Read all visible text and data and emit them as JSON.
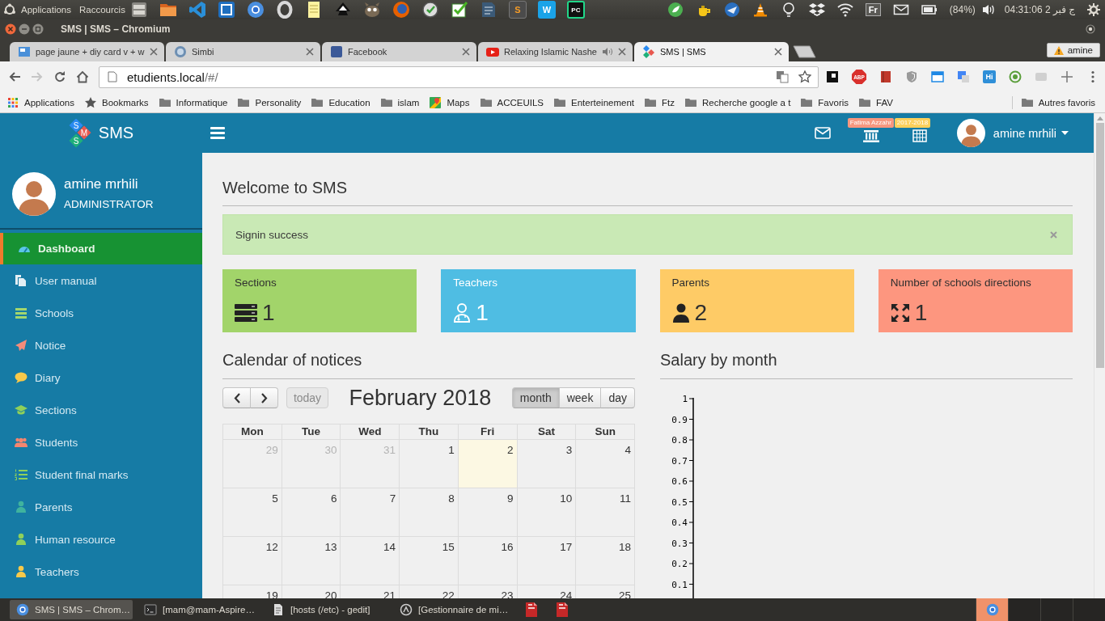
{
  "top_panel": {
    "menus": [
      "Applications",
      "Raccourcis"
    ],
    "launcher_labels": [
      "S",
      "W",
      "PC"
    ],
    "keyboard_layout": "Fr",
    "battery": "(84%)",
    "clock": "ج فبر 2 04:31:06"
  },
  "window": {
    "title": "SMS | SMS – Chromium"
  },
  "browser": {
    "tabs": [
      {
        "label": "page jaune + diy card v + w",
        "selected": false,
        "audio": false
      },
      {
        "label": "Simbi",
        "selected": false,
        "audio": false
      },
      {
        "label": "Facebook",
        "selected": false,
        "audio": false
      },
      {
        "label": "Relaxing Islamic Nashe",
        "selected": false,
        "audio": true
      },
      {
        "label": "SMS | SMS",
        "selected": true,
        "audio": false
      }
    ],
    "profile": "amine",
    "forward_disabled": true,
    "address": {
      "host": "etudients.local",
      "path": "/#/"
    },
    "extension_labels": [
      "ABP",
      "Hi"
    ],
    "bookmarks": [
      {
        "kind": "apps",
        "label": "Applications"
      },
      {
        "kind": "star",
        "label": "Bookmarks"
      },
      {
        "kind": "folder",
        "label": "Informatique"
      },
      {
        "kind": "folder",
        "label": "Personality"
      },
      {
        "kind": "folder",
        "label": "Education"
      },
      {
        "kind": "folder",
        "label": "islam"
      },
      {
        "kind": "site",
        "label": "Maps"
      },
      {
        "kind": "folder",
        "label": "ACCEUILS"
      },
      {
        "kind": "folder",
        "label": "Enterteinement"
      },
      {
        "kind": "folder",
        "label": "Ftz"
      },
      {
        "kind": "folder",
        "label": "Recherche google a t"
      },
      {
        "kind": "folder",
        "label": "Favoris"
      },
      {
        "kind": "folder",
        "label": "FAV"
      }
    ],
    "other_bookmarks": "Autres favoris"
  },
  "app": {
    "logo_letters": [
      "S",
      "M",
      "S"
    ],
    "brand": "SMS",
    "badges": [
      {
        "text": "Fatima Azzahr",
        "color": "#f7977f"
      },
      {
        "text": "2017-2018",
        "color": "#fcd05c"
      }
    ],
    "user": "amine mrhili",
    "sidebar": {
      "name": "amine mrhili",
      "role": "ADMINISTRATOR",
      "items": [
        {
          "label": "Dashboard",
          "selected": true
        },
        {
          "label": "User manual",
          "selected": false
        },
        {
          "label": "Schools",
          "selected": false
        },
        {
          "label": "Notice",
          "selected": false
        },
        {
          "label": "Diary",
          "selected": false
        },
        {
          "label": "Sections",
          "selected": false
        },
        {
          "label": "Students",
          "selected": false
        },
        {
          "label": "Student final marks",
          "selected": false
        },
        {
          "label": "Parents",
          "selected": false
        },
        {
          "label": "Human resource",
          "selected": false
        },
        {
          "label": "Teachers",
          "selected": false
        }
      ]
    },
    "page": {
      "title": "Welcome to SMS",
      "alert": {
        "text": "Signin success"
      },
      "stats": [
        {
          "label": "Sections",
          "count": "1",
          "color": "#a2d46a"
        },
        {
          "label": "Teachers",
          "count": "1",
          "color": "#4fbde3"
        },
        {
          "label": "Parents",
          "count": "2",
          "color": "#fecb66"
        },
        {
          "label": "Number of schools directions",
          "count": "1",
          "color": "#fd967f"
        }
      ],
      "calendar": {
        "title": "Calendar of notices",
        "today_button": {
          "label": "today",
          "disabled": true
        },
        "month": "February 2018",
        "views": [
          {
            "label": "month",
            "selected": true
          },
          {
            "label": "week",
            "selected": false
          },
          {
            "label": "day",
            "selected": false
          }
        ],
        "weekdays": [
          "Mon",
          "Tue",
          "Wed",
          "Thu",
          "Fri",
          "Sat",
          "Sun"
        ],
        "weeks": [
          [
            {
              "day": "29",
              "other_month": true,
              "today": false
            },
            {
              "day": "30",
              "other_month": true,
              "today": false
            },
            {
              "day": "31",
              "other_month": true,
              "today": false
            },
            {
              "day": "1",
              "other_month": false,
              "today": false
            },
            {
              "day": "2",
              "other_month": false,
              "today": true
            },
            {
              "day": "3",
              "other_month": false,
              "today": false
            },
            {
              "day": "4",
              "other_month": false,
              "today": false
            }
          ],
          [
            {
              "day": "5",
              "other_month": false,
              "today": false
            },
            {
              "day": "6",
              "other_month": false,
              "today": false
            },
            {
              "day": "7",
              "other_month": false,
              "today": false
            },
            {
              "day": "8",
              "other_month": false,
              "today": false
            },
            {
              "day": "9",
              "other_month": false,
              "today": false
            },
            {
              "day": "10",
              "other_month": false,
              "today": false
            },
            {
              "day": "11",
              "other_month": false,
              "today": false
            }
          ],
          [
            {
              "day": "12",
              "other_month": false,
              "today": false
            },
            {
              "day": "13",
              "other_month": false,
              "today": false
            },
            {
              "day": "14",
              "other_month": false,
              "today": false
            },
            {
              "day": "15",
              "other_month": false,
              "today": false
            },
            {
              "day": "16",
              "other_month": false,
              "today": false
            },
            {
              "day": "17",
              "other_month": false,
              "today": false
            },
            {
              "day": "18",
              "other_month": false,
              "today": false
            }
          ],
          [
            {
              "day": "19",
              "other_month": false,
              "today": false
            },
            {
              "day": "20",
              "other_month": false,
              "today": false
            },
            {
              "day": "21",
              "other_month": false,
              "today": false
            },
            {
              "day": "22",
              "other_month": false,
              "today": false
            },
            {
              "day": "23",
              "other_month": false,
              "today": false
            },
            {
              "day": "24",
              "other_month": false,
              "today": false
            },
            {
              "day": "25",
              "other_month": false,
              "today": false
            }
          ]
        ]
      },
      "salary": {
        "title": "Salary by month",
        "y_axis_labels": [
          "1",
          "0.9",
          "0.8",
          "0.7",
          "0.6",
          "0.5",
          "0.4",
          "0.3",
          "0.2",
          "0.1"
        ]
      }
    }
  },
  "taskbar": {
    "windows": [
      {
        "label": "SMS | SMS – Chrom…",
        "selected": true
      },
      {
        "label": "[mam@mam-Aspire…",
        "selected": false
      },
      {
        "label": "[hosts (/etc) - gedit]",
        "selected": false
      },
      {
        "label": "[Gestionnaire de mi…",
        "selected": false
      }
    ],
    "workspaces": [
      {
        "selected": true
      },
      {
        "selected": false
      },
      {
        "selected": false
      },
      {
        "selected": false
      }
    ]
  }
}
